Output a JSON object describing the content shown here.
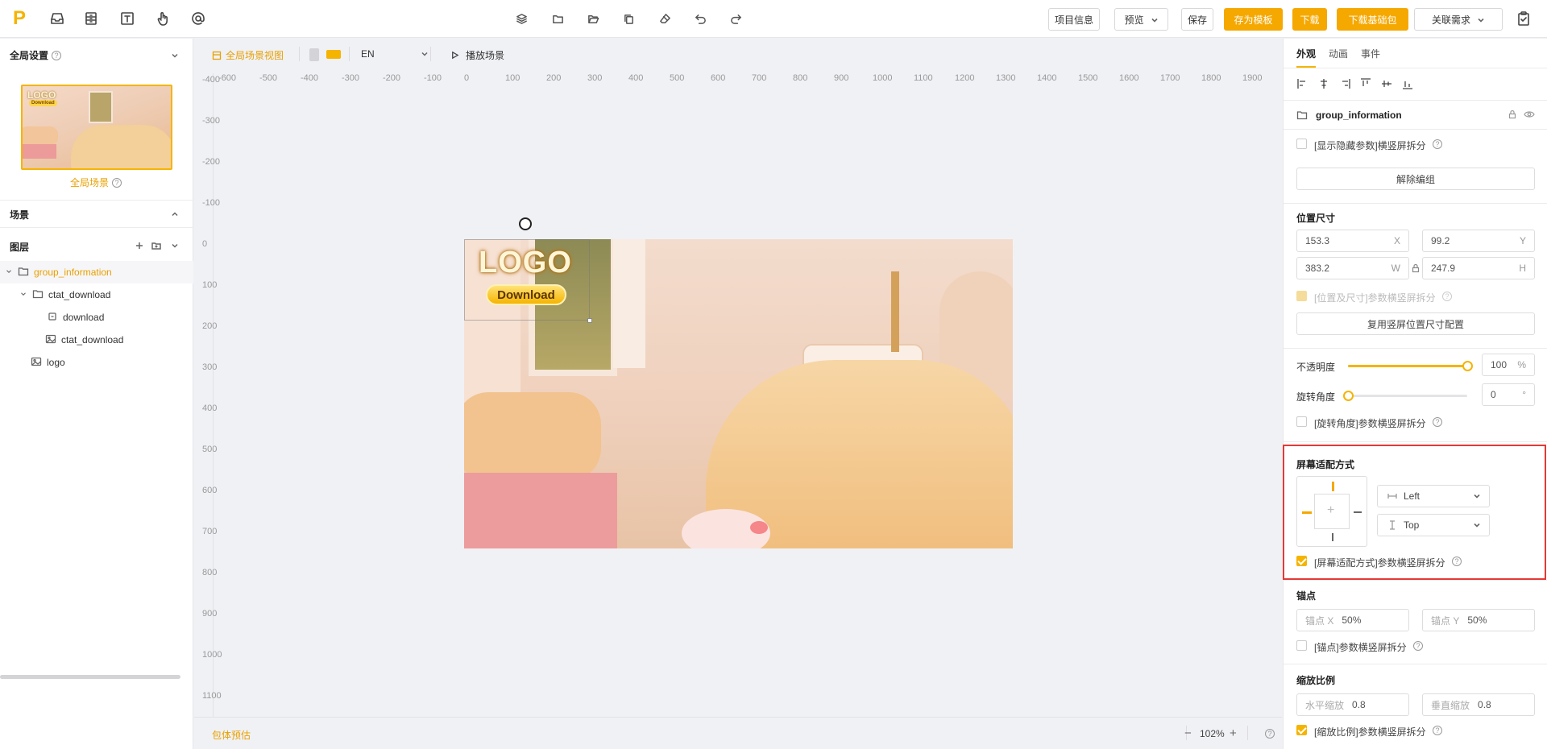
{
  "toolbar": {
    "logo_letter": "P",
    "buttons": {
      "project_info": "项目信息",
      "preview": "预览",
      "save": "保存",
      "save_template": "存为模板",
      "download": "下载",
      "download_base": "下载基础包",
      "link_requirement": "关联需求"
    }
  },
  "left_panel": {
    "global_settings": "全局设置",
    "global_scene": "全局场景",
    "scene": "场景",
    "layers": "图层",
    "layer_tree": [
      {
        "label": "group_information",
        "icon": "folder-icon",
        "selected": true
      },
      {
        "label": "ctat_download",
        "icon": "folder-icon",
        "selected": false
      },
      {
        "label": "download",
        "icon": "button-icon",
        "selected": false
      },
      {
        "label": "ctat_download",
        "icon": "image-icon",
        "selected": false
      },
      {
        "label": "logo",
        "icon": "image-icon",
        "selected": false
      }
    ]
  },
  "canvas": {
    "view_label": "全局场景视图",
    "language": "EN",
    "play_label": "播放场景",
    "ruler_x": [
      "-600",
      "-500",
      "-400",
      "-300",
      "-200",
      "-100",
      "0",
      "100",
      "200",
      "300",
      "400",
      "500",
      "600",
      "700",
      "800",
      "900",
      "1000",
      "1100",
      "1200",
      "1300",
      "1400",
      "1500",
      "1600",
      "1700",
      "1800",
      "1900"
    ],
    "ruler_y": [
      "-400",
      "-300",
      "-200",
      "-100",
      "0",
      "100",
      "200",
      "300",
      "400",
      "500",
      "600",
      "700",
      "800",
      "900",
      "1000",
      "1100"
    ],
    "stage_logo": "LOGO",
    "stage_button": "Download",
    "package_estimate": "包体预估",
    "zoom": "102%",
    "zoom_minus": "−",
    "zoom_plus": "+"
  },
  "right_panel": {
    "tabs": [
      "外观",
      "动画",
      "事件"
    ],
    "active_tab": "外观",
    "layer_name": "group_information",
    "show_hidden_params": "[显示隐藏参数]横竖屏拆分",
    "ungroup": "解除编组",
    "position_size": {
      "title": "位置尺寸",
      "x": "153.3",
      "x_label": "X",
      "y": "99.2",
      "y_label": "Y",
      "w": "383.2",
      "w_label": "W",
      "h": "247.9",
      "h_label": "H",
      "split_label": "[位置及尺寸]参数横竖屏拆分",
      "reuse_button": "复用竖屏位置尺寸配置"
    },
    "opacity": {
      "label": "不透明度",
      "value": "100",
      "unit": "%",
      "fraction": 1.0
    },
    "rotation": {
      "label": "旋转角度",
      "value": "0",
      "unit": "°",
      "fraction": 0.0,
      "split_label": "[旋转角度]参数横竖屏拆分"
    },
    "screen_fit": {
      "title": "屏幕适配方式",
      "horizontal": "Left",
      "vertical": "Top",
      "split_label": "[屏幕适配方式]参数横竖屏拆分"
    },
    "anchor": {
      "title": "锚点",
      "x_label": "锚点 X",
      "x_value": "50%",
      "y_label": "锚点 Y",
      "y_value": "50%",
      "split_label": "[锚点]参数横竖屏拆分"
    },
    "scale": {
      "title": "缩放比例",
      "h_label": "水平缩放",
      "h_value": "0.8",
      "v_label": "垂直缩放",
      "v_value": "0.8",
      "split_label": "[缩放比例]参数横竖屏拆分"
    }
  },
  "colors": {
    "accent": "#f5a800",
    "highlight_box": "#e53935"
  }
}
